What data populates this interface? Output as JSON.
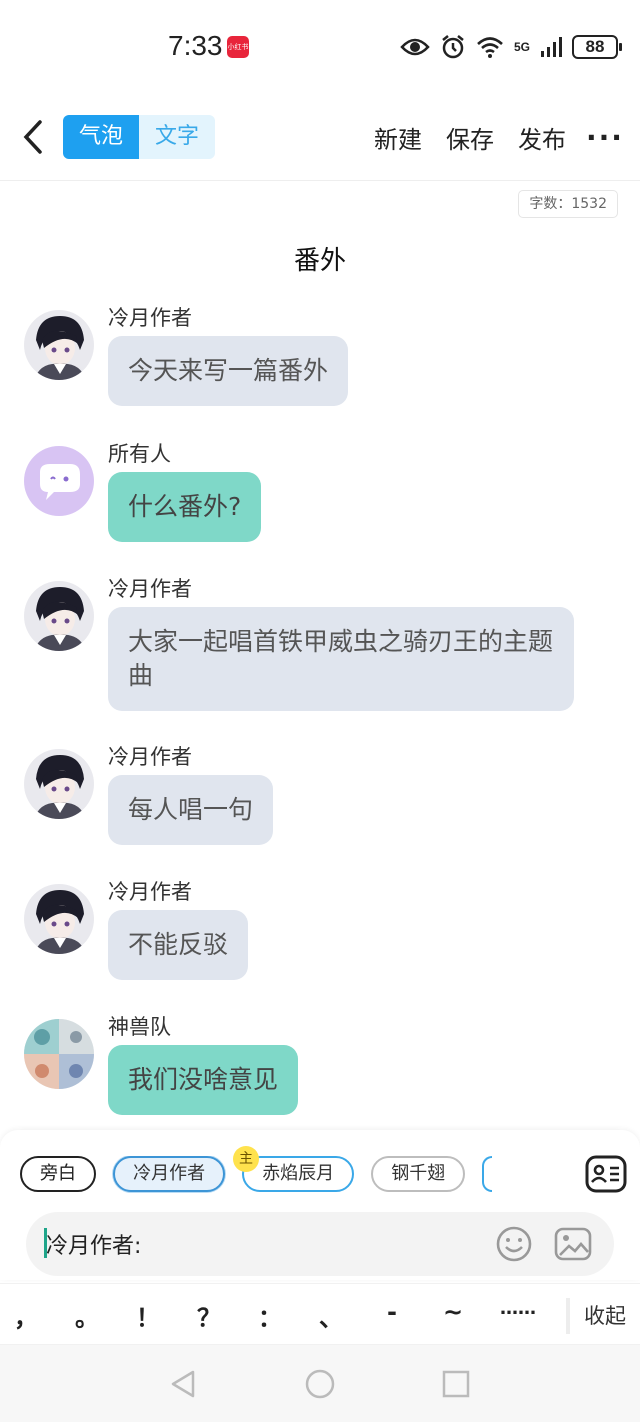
{
  "status_bar": {
    "time": "7:33",
    "app_badge": "小红书",
    "network": "5G",
    "battery": "88"
  },
  "topbar": {
    "tabs": [
      {
        "label": "气泡",
        "active": true
      },
      {
        "label": "文字",
        "active": false
      }
    ],
    "actions": [
      "新建",
      "保存",
      "发布"
    ],
    "more": "···"
  },
  "word_count": "字数：1532",
  "title": "番外",
  "messages": [
    {
      "name": "冷月作者",
      "text": "今天来写一篇番外",
      "style": "grey"
    },
    {
      "name": "所有人",
      "text": "什么番外?",
      "style": "teal"
    },
    {
      "name": "冷月作者",
      "text": "大家一起唱首铁甲威虫之骑刃王的主题曲",
      "style": "grey"
    },
    {
      "name": "冷月作者",
      "text": "每人唱一句",
      "style": "grey"
    },
    {
      "name": "冷月作者",
      "text": "不能反驳",
      "style": "grey"
    },
    {
      "name": "神兽队",
      "text": "我们没啥意见",
      "style": "teal"
    }
  ],
  "roles": [
    {
      "label": "旁白"
    },
    {
      "label": "冷月作者"
    },
    {
      "label": "赤焰辰月"
    },
    {
      "label": "钢千翅"
    }
  ],
  "main_badge": "主",
  "input": {
    "value": "冷月作者:"
  },
  "punctuation": [
    "，",
    "。",
    "！",
    "？",
    "：",
    "、",
    "-",
    "~",
    "……"
  ],
  "collapse": "收起",
  "colors": {
    "accent": "#1ea0f0",
    "bubble_grey": "#e0e5ee",
    "bubble_teal": "#7fd8c8"
  }
}
